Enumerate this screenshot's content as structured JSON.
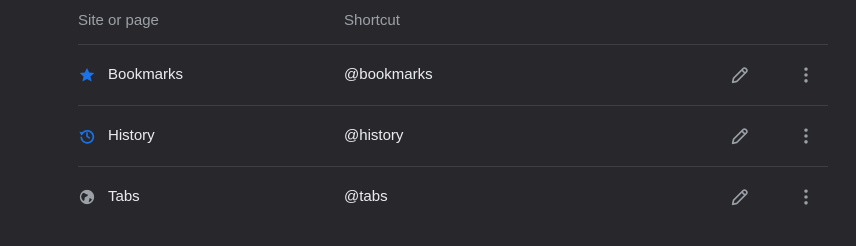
{
  "header": {
    "site_col_label": "Site or page",
    "shortcut_col_label": "Shortcut"
  },
  "rows": [
    {
      "label": "Bookmarks",
      "shortcut": "@bookmarks",
      "icon": "star-icon",
      "icon_color": "#1a73e8"
    },
    {
      "label": "History",
      "shortcut": "@history",
      "icon": "history-icon",
      "icon_color": "#1a73e8"
    },
    {
      "label": "Tabs",
      "shortcut": "@tabs",
      "icon": "globe-icon",
      "icon_color": "#9aa0a6"
    }
  ],
  "colors": {
    "background": "#28282c",
    "divider": "#3f3f44",
    "text_primary": "#e8eaed",
    "text_secondary": "#9aa0a6",
    "accent": "#1a73e8"
  }
}
